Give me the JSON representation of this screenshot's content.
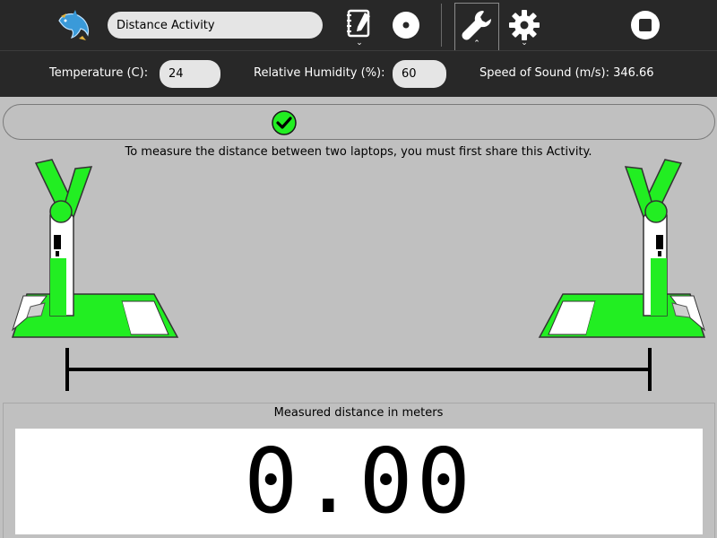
{
  "toolbar": {
    "activity_title": "Distance Activity",
    "icons": {
      "activity": "dolphin-activity-icon",
      "journal": "journal-notebook-icon",
      "share": "share-network-icon",
      "tools": "wrench-icon",
      "settings": "gear-icon",
      "stop": "stop-icon"
    }
  },
  "settings": {
    "temperature_label": "Temperature (C):",
    "temperature_value": "24",
    "humidity_label": "Relative Humidity (%):",
    "humidity_value": "60",
    "speed_label": "Speed of Sound (m/s): 346.66"
  },
  "status": {
    "icon": "checkmark-icon",
    "message": "To measure the distance between two laptops, you must first share this Activity."
  },
  "result": {
    "label": "Measured distance in meters",
    "value": "0.00"
  },
  "colors": {
    "toolbar": "#282828",
    "background": "#c0c0c0",
    "xo_green": "#22ee22"
  }
}
